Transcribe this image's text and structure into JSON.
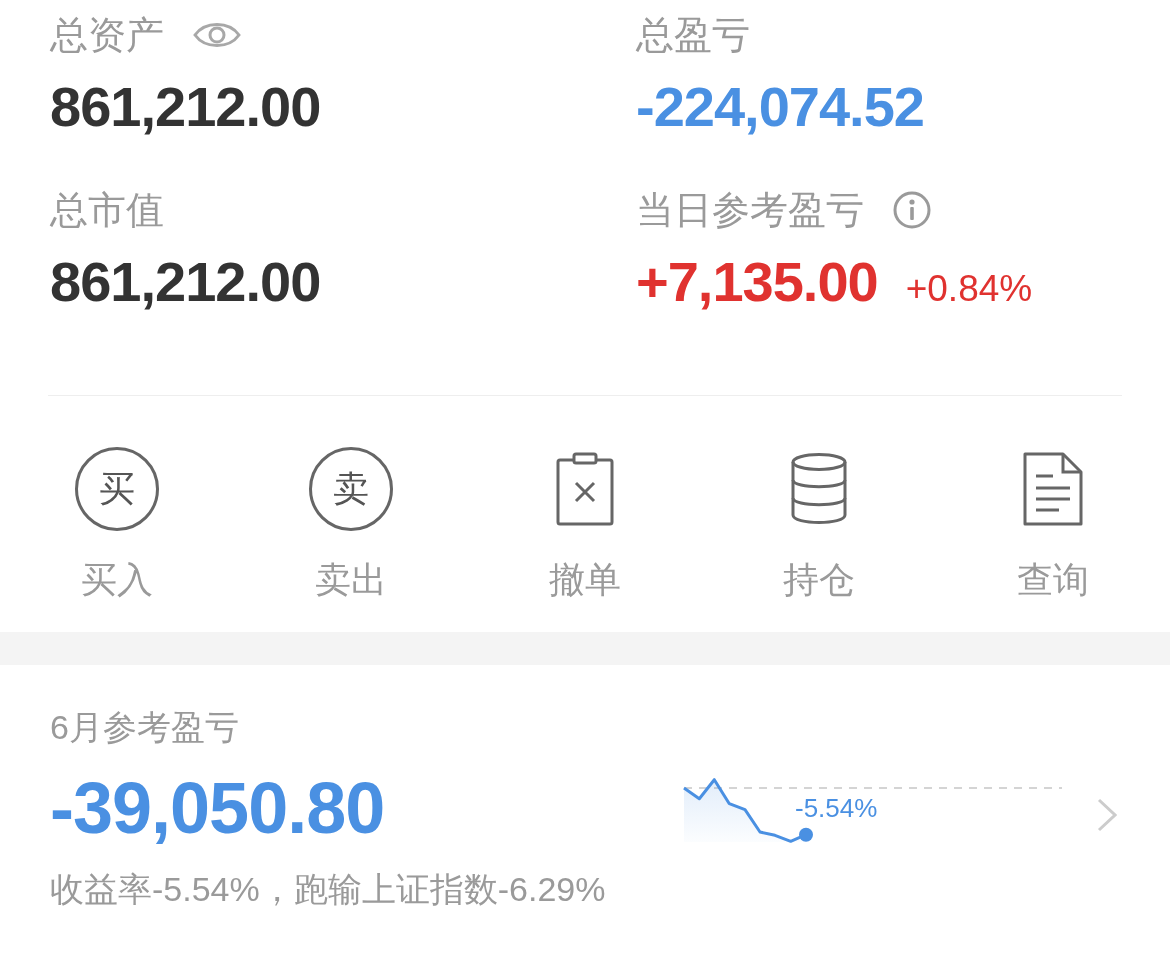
{
  "summary": {
    "items": [
      {
        "label": "总资产",
        "value": "861,212.00",
        "color": "#333333"
      },
      {
        "label": "总盈亏",
        "value": "-224,074.52",
        "color": "#4a90e2"
      },
      {
        "label": "总市值",
        "value": "861,212.00",
        "color": "#333333"
      },
      {
        "label": "当日参考盈亏",
        "value": "+7,135.00",
        "change": "+0.84%",
        "color": "#e0322f"
      }
    ]
  },
  "actions": [
    {
      "kind": "circled_char",
      "icon_char": "买",
      "label": "买入"
    },
    {
      "kind": "circled_char",
      "icon_char": "卖",
      "label": "卖出"
    },
    {
      "kind": "clipboard_x",
      "label": "撤单"
    },
    {
      "kind": "database",
      "label": "持仓"
    },
    {
      "kind": "document",
      "label": "查询"
    }
  ],
  "monthly": {
    "title": "6月参考盈亏",
    "value": "-39,050.80",
    "color": "#4a90e2",
    "chart_label": "-5.54%",
    "summary": "收益率-5.54%，跑输上证指数-6.29%"
  }
}
